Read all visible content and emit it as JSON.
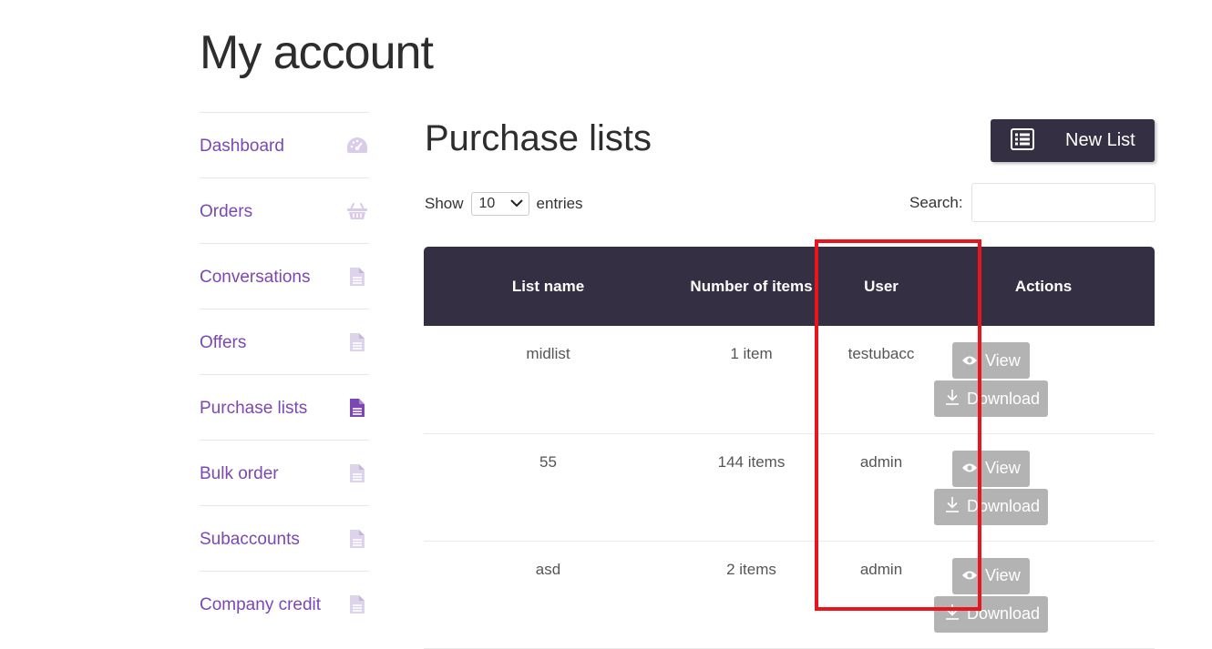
{
  "page": {
    "title": "My account"
  },
  "sidebar": {
    "items": [
      {
        "label": "Dashboard",
        "icon": "dashboard-icon",
        "active": false
      },
      {
        "label": "Orders",
        "icon": "basket-icon",
        "active": false
      },
      {
        "label": "Conversations",
        "icon": "file-icon",
        "active": false
      },
      {
        "label": "Offers",
        "icon": "file-icon",
        "active": false
      },
      {
        "label": "Purchase lists",
        "icon": "file-icon",
        "active": true
      },
      {
        "label": "Bulk order",
        "icon": "file-icon",
        "active": false
      },
      {
        "label": "Subaccounts",
        "icon": "file-icon",
        "active": false
      },
      {
        "label": "Company credit",
        "icon": "file-icon",
        "active": false
      }
    ]
  },
  "main": {
    "title": "Purchase lists",
    "new_list_label": "New List",
    "show_label": "Show",
    "entries_value": "10",
    "entries_label": "entries",
    "search_label": "Search:",
    "search_value": ""
  },
  "table": {
    "headers": [
      "List name",
      "Number of items",
      "User",
      "Actions"
    ],
    "rows": [
      {
        "name": "midlist",
        "items": "1 item",
        "user": "testubacc"
      },
      {
        "name": "55",
        "items": "144 items",
        "user": "admin"
      },
      {
        "name": "asd",
        "items": "2 items",
        "user": "admin"
      }
    ],
    "view_label": "View",
    "download_label": "Download"
  },
  "colors": {
    "accent": "#7b48b3",
    "header_bg": "#342f42",
    "button_gray": "#b3b3b3",
    "highlight": "#e8161c"
  }
}
